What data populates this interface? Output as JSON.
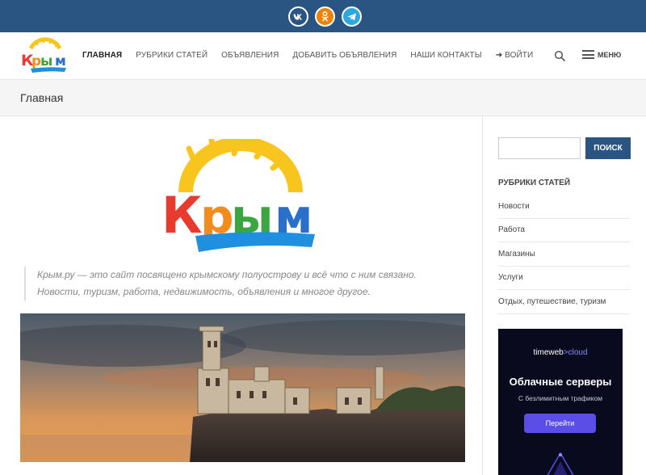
{
  "social": {
    "vk_label": "vk",
    "ok_label": "ok",
    "tg_label": "telegram"
  },
  "logo": {
    "text": "Крым"
  },
  "nav": {
    "items": [
      {
        "label": "Главная",
        "active": true
      },
      {
        "label": "Рубрики статей"
      },
      {
        "label": "Объявления"
      },
      {
        "label": "Добавить объявления"
      },
      {
        "label": "Наши контакты"
      },
      {
        "label": "Войти",
        "icon": "login-icon"
      }
    ],
    "menu_label": "Меню"
  },
  "page": {
    "title": "Главная"
  },
  "main": {
    "quote": "Крым.ру — это сайт посвящено крымскому полуострову и всё что с ним связано. Новости, туризм, работа, недвижимость, объявления и многое другое."
  },
  "sidebar": {
    "search_button": "Поиск",
    "widget_title": "Рубрики статей",
    "categories": [
      "Новости",
      "Работа",
      "Магазины",
      "Услуги",
      "Отдых, путешествие, туризм"
    ],
    "ad": {
      "brand_part1": "timeweb",
      "brand_part2": "cloud",
      "headline": "Облачные серверы",
      "subline": "С безлимитным трафиком",
      "button": "Перейти"
    }
  },
  "colors": {
    "topbar": "#2a5482",
    "primary": "#2a5482",
    "ok": "#ee8208",
    "telegram": "#2ea6e0",
    "ad_bg": "#0a0a1f",
    "ad_button": "#5b4ee8"
  }
}
